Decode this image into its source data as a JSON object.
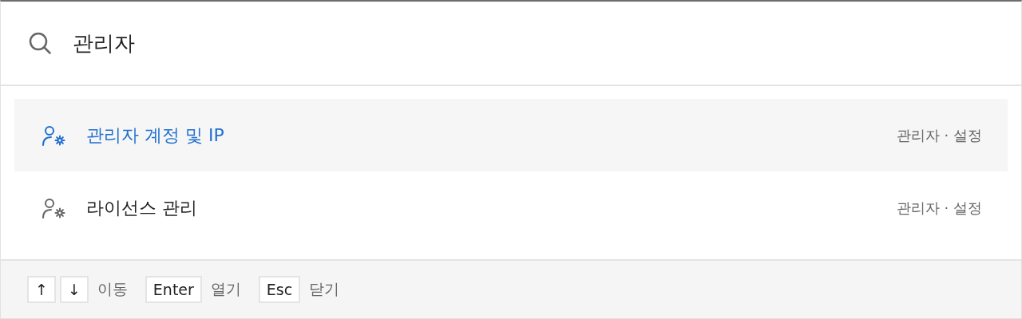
{
  "search": {
    "value": "관리자"
  },
  "results": [
    {
      "title": "관리자 계정 및 IP",
      "path": "관리자 · 설정",
      "selected": true
    },
    {
      "title": "라이선스 관리",
      "path": "관리자 · 설정",
      "selected": false
    }
  ],
  "hints": [
    {
      "keys": [
        "↑",
        "↓"
      ],
      "label": "이동"
    },
    {
      "keys": [
        "Enter"
      ],
      "label": "열기"
    },
    {
      "keys": [
        "Esc"
      ],
      "label": "닫기"
    }
  ]
}
